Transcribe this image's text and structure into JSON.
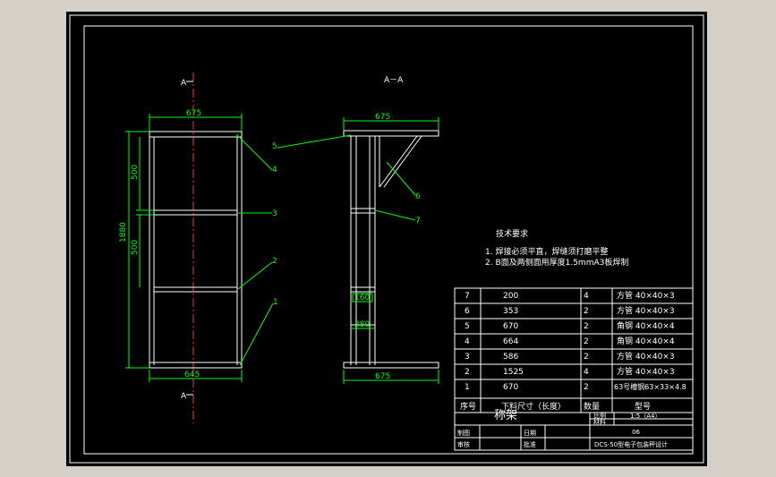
{
  "drawing": {
    "front_view": {
      "section_marker": "A",
      "dim_top": "675",
      "dim_bottom": "645",
      "dim_height": "1880",
      "dim_upper": "500",
      "dim_lower": "500"
    },
    "section_view": {
      "title": "A－A",
      "dim_top": "675",
      "dim_bottom": "675",
      "dim_160": "160",
      "dim_280": "280"
    },
    "callouts": [
      "1",
      "2",
      "3",
      "4",
      "5",
      "6",
      "7"
    ],
    "tech_notes": {
      "heading": "技术要求",
      "line1": "1. 焊接必须平直，焊缝须打磨平整",
      "line2": "2. B面及两侧面用厚度1.5mmA3板焊制"
    },
    "bom": {
      "header": {
        "no": "序号",
        "length": "下料尺寸（长度）",
        "qty": "数量",
        "spec": "型号"
      },
      "rows": [
        {
          "no": "7",
          "length": "200",
          "qty": "4",
          "spec": "方管 40×40×3"
        },
        {
          "no": "6",
          "length": "353",
          "qty": "2",
          "spec": "方管 40×40×3"
        },
        {
          "no": "5",
          "length": "670",
          "qty": "2",
          "spec": "角钢 40×40×4"
        },
        {
          "no": "4",
          "length": "664",
          "qty": "2",
          "spec": "角钢 40×40×4"
        },
        {
          "no": "3",
          "length": "586",
          "qty": "2",
          "spec": "方管 40×40×3"
        },
        {
          "no": "2",
          "length": "1525",
          "qty": "4",
          "spec": "方管 40×40×3"
        },
        {
          "no": "1",
          "length": "670",
          "qty": "2",
          "spec": "63号槽钢63×33×4.8"
        }
      ]
    },
    "title_block": {
      "name": "称架",
      "scale_label": "比例",
      "scale_value": "1:5（A4）",
      "material_label": "材料",
      "drawn_label": "制图",
      "date_label": "日期",
      "check_label": "审核",
      "approve_label": "批准",
      "code": "06",
      "project": "DCS-50型电子包装秤设计"
    }
  }
}
